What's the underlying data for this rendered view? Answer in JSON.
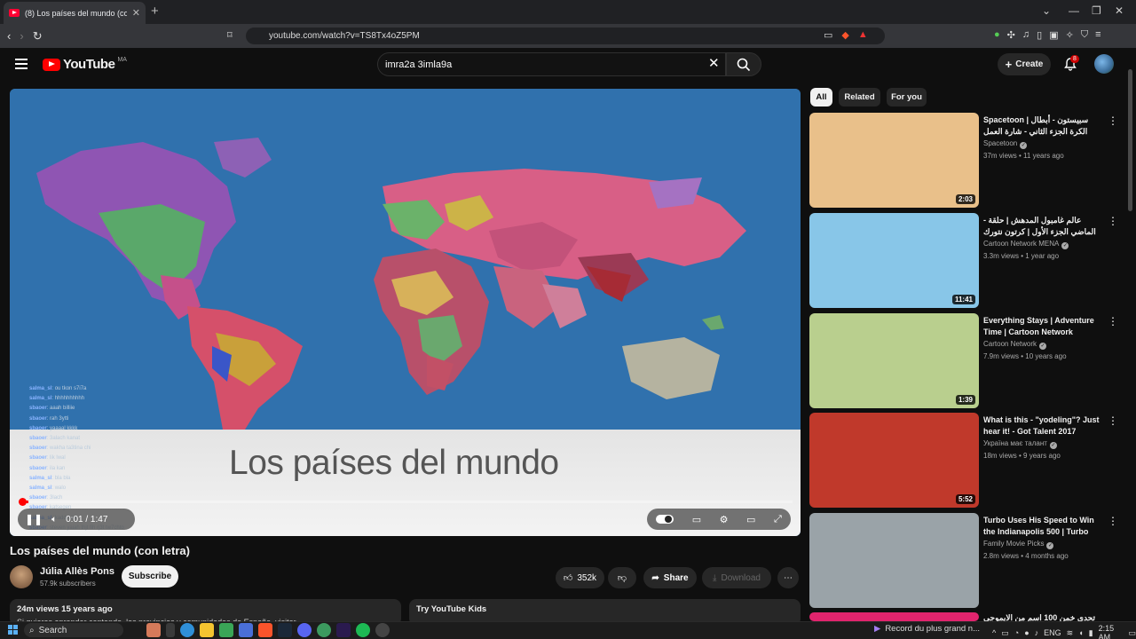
{
  "browser": {
    "tab_title": "(8) Los países del mundo (co",
    "new_tab": "+",
    "url": "youtube.com/watch?v=TS8Tx4oZ5PM"
  },
  "header": {
    "logo_text": "YouTube",
    "country": "MA",
    "search_value": "imra2a 3imla9a",
    "create_label": "Create",
    "notification_count": "8"
  },
  "player": {
    "overlay_title": "Los países del mundo",
    "time_current": "0:01",
    "time_separator": "/",
    "time_total": "1:47",
    "progress_fraction": 0.01,
    "chat_lines": [
      {
        "user": "salma_sl",
        "msg": ": ou tkon s7i7a"
      },
      {
        "user": "salma_sl",
        "msg": ": hhhhhhhhhh"
      },
      {
        "user": "sbaoer",
        "msg": ": aaah billiie"
      },
      {
        "user": "sbaoer",
        "msg": ": rah 3ytti"
      },
      {
        "user": "sbaoer",
        "msg": ": yaaaal kkkk"
      },
      {
        "user": "sbaoer",
        "msg": ": 3alach kanat"
      },
      {
        "user": "sbaoer",
        "msg": ": wakha ta3tina chi"
      },
      {
        "user": "sbaoer",
        "msg": ": lik lwal"
      },
      {
        "user": "sbaoer",
        "msg": ": ila kan"
      },
      {
        "user": "salma_sl",
        "msg": ": bla bla"
      },
      {
        "user": "salma_sl",
        "msg": ": walo"
      },
      {
        "user": "sbaoer",
        "msg": ": 3lach"
      },
      {
        "user": "sbaoer",
        "msg": ": katsegen"
      },
      {
        "user": "salma_sl",
        "msg": ": kaddoum"
      },
      {
        "user": "sbaoer",
        "msg": ": steven yaiah thjt fih rj3t tw7chto"
      }
    ]
  },
  "video": {
    "title": "Los países del mundo (con letra)",
    "channel": "Júlia Allès Pons",
    "subscribers": "57.9k subscribers",
    "subscribe_label": "Subscribe",
    "likes": "352k",
    "share_label": "Share",
    "download_label": "Download",
    "views_date": "24m views  15 years ago",
    "description_snippet": "Si quieres aprender cantando, los provincias y comunidades de España, visitar",
    "kids_label": "Try YouTube Kids"
  },
  "sidebar": {
    "chips": [
      "All",
      "Related",
      "For you"
    ],
    "videos": [
      {
        "title": "Spacetoon | سبيستون - أبطال الكرة الجزء الثاني - شارة العمل",
        "channel": "Spacetoon",
        "meta": "37m views • 11 years ago",
        "duration": "2:03",
        "thumb_color": "#e9c08a"
      },
      {
        "title": "عالم غامبول المدهش | حلقة - الماضي الجزء الأول | كرتون نتورك",
        "channel": "Cartoon Network MENA",
        "meta": "3.3m views • 1 year ago",
        "duration": "11:41",
        "thumb_color": "#88c6e8"
      },
      {
        "title": "Everything Stays | Adventure Time | Cartoon Network",
        "channel": "Cartoon Network",
        "meta": "7.9m views • 10 years ago",
        "duration": "1:39",
        "thumb_color": "#b9cf8e"
      },
      {
        "title": "What is this - \"yodeling\"? Just hear it! - Got Talent 2017",
        "channel": "Україна має талант",
        "meta": "18m views • 9 years ago",
        "duration": "5:52",
        "thumb_color": "#c0392b"
      },
      {
        "title": "Turbo Uses His Speed to Win the Indianapolis 500 | Turbo",
        "channel": "Family Movie Picks",
        "meta": "2.8m views • 4 months ago",
        "duration": "",
        "thumb_color": "#9aa3a8"
      },
      {
        "title": "تحدي خمن 100 اسم من الايموجي",
        "channel": "",
        "meta": "",
        "duration": "",
        "thumb_color": "#e0246d"
      }
    ]
  },
  "taskbar": {
    "search_label": "Search",
    "now_playing": "Record du plus grand n...",
    "language": "ENG",
    "time": "2:15 AM"
  }
}
